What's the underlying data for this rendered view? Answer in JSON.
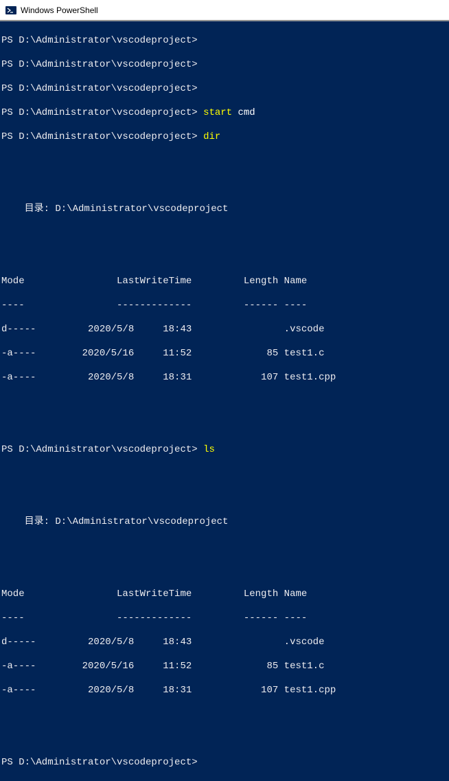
{
  "titlebar": {
    "title": "Windows PowerShell"
  },
  "prompt": "PS D:\\Administrator\\vscodeproject>",
  "lines": {
    "l0": "PS D:\\Administrator\\vscodeproject>",
    "l1": "PS D:\\Administrator\\vscodeproject>",
    "l2": "PS D:\\Administrator\\vscodeproject>",
    "l3_prompt": "PS D:\\Administrator\\vscodeproject> ",
    "l3_cmd1": "start",
    "l3_arg": " cmd",
    "l4_prompt": "PS D:\\Administrator\\vscodeproject> ",
    "l4_cmd": "dir",
    "dir_label": "    目录: D:\\Administrator\\vscodeproject",
    "header_mode": "Mode                LastWriteTime         Length Name",
    "header_dash": "----                -------------         ------ ----",
    "r1": "d-----         2020/5/8     18:43                .vscode",
    "r2": "-a----        2020/5/16     11:52             85 test1.c",
    "r3": "-a----         2020/5/8     18:31            107 test1.cpp",
    "l5_prompt": "PS D:\\Administrator\\vscodeproject> ",
    "l5_cmd": "ls",
    "dir_label2": "    目录: D:\\Administrator\\vscodeproject",
    "header_mode2": "Mode                LastWriteTime         Length Name",
    "header_dash2": "----                -------------         ------ ----",
    "r4": "d-----         2020/5/8     18:43                .vscode",
    "r5": "-a----        2020/5/16     11:52             85 test1.c",
    "r6": "-a----         2020/5/8     18:31            107 test1.cpp",
    "l6": "PS D:\\Administrator\\vscodeproject>"
  }
}
